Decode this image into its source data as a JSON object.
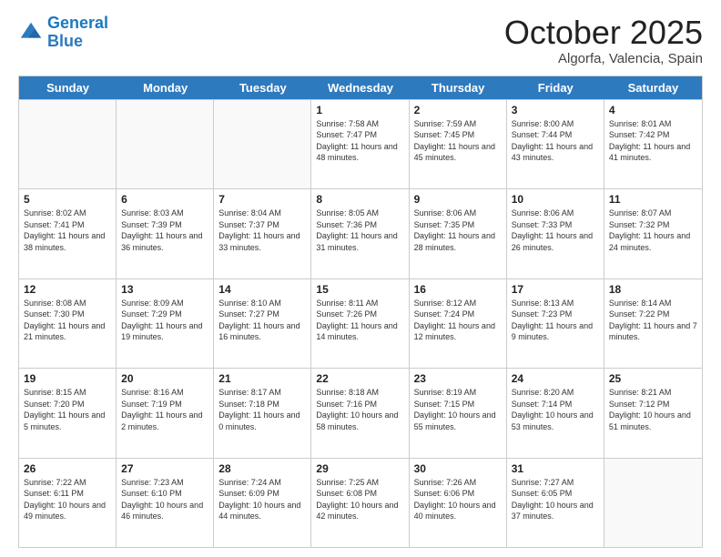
{
  "logo": {
    "line1": "General",
    "line2": "Blue"
  },
  "header": {
    "month": "October 2025",
    "location": "Algorfa, Valencia, Spain"
  },
  "weekdays": [
    "Sunday",
    "Monday",
    "Tuesday",
    "Wednesday",
    "Thursday",
    "Friday",
    "Saturday"
  ],
  "weeks": [
    [
      {
        "day": "",
        "sunrise": "",
        "sunset": "",
        "daylight": ""
      },
      {
        "day": "",
        "sunrise": "",
        "sunset": "",
        "daylight": ""
      },
      {
        "day": "",
        "sunrise": "",
        "sunset": "",
        "daylight": ""
      },
      {
        "day": "1",
        "sunrise": "Sunrise: 7:58 AM",
        "sunset": "Sunset: 7:47 PM",
        "daylight": "Daylight: 11 hours and 48 minutes."
      },
      {
        "day": "2",
        "sunrise": "Sunrise: 7:59 AM",
        "sunset": "Sunset: 7:45 PM",
        "daylight": "Daylight: 11 hours and 45 minutes."
      },
      {
        "day": "3",
        "sunrise": "Sunrise: 8:00 AM",
        "sunset": "Sunset: 7:44 PM",
        "daylight": "Daylight: 11 hours and 43 minutes."
      },
      {
        "day": "4",
        "sunrise": "Sunrise: 8:01 AM",
        "sunset": "Sunset: 7:42 PM",
        "daylight": "Daylight: 11 hours and 41 minutes."
      }
    ],
    [
      {
        "day": "5",
        "sunrise": "Sunrise: 8:02 AM",
        "sunset": "Sunset: 7:41 PM",
        "daylight": "Daylight: 11 hours and 38 minutes."
      },
      {
        "day": "6",
        "sunrise": "Sunrise: 8:03 AM",
        "sunset": "Sunset: 7:39 PM",
        "daylight": "Daylight: 11 hours and 36 minutes."
      },
      {
        "day": "7",
        "sunrise": "Sunrise: 8:04 AM",
        "sunset": "Sunset: 7:37 PM",
        "daylight": "Daylight: 11 hours and 33 minutes."
      },
      {
        "day": "8",
        "sunrise": "Sunrise: 8:05 AM",
        "sunset": "Sunset: 7:36 PM",
        "daylight": "Daylight: 11 hours and 31 minutes."
      },
      {
        "day": "9",
        "sunrise": "Sunrise: 8:06 AM",
        "sunset": "Sunset: 7:35 PM",
        "daylight": "Daylight: 11 hours and 28 minutes."
      },
      {
        "day": "10",
        "sunrise": "Sunrise: 8:06 AM",
        "sunset": "Sunset: 7:33 PM",
        "daylight": "Daylight: 11 hours and 26 minutes."
      },
      {
        "day": "11",
        "sunrise": "Sunrise: 8:07 AM",
        "sunset": "Sunset: 7:32 PM",
        "daylight": "Daylight: 11 hours and 24 minutes."
      }
    ],
    [
      {
        "day": "12",
        "sunrise": "Sunrise: 8:08 AM",
        "sunset": "Sunset: 7:30 PM",
        "daylight": "Daylight: 11 hours and 21 minutes."
      },
      {
        "day": "13",
        "sunrise": "Sunrise: 8:09 AM",
        "sunset": "Sunset: 7:29 PM",
        "daylight": "Daylight: 11 hours and 19 minutes."
      },
      {
        "day": "14",
        "sunrise": "Sunrise: 8:10 AM",
        "sunset": "Sunset: 7:27 PM",
        "daylight": "Daylight: 11 hours and 16 minutes."
      },
      {
        "day": "15",
        "sunrise": "Sunrise: 8:11 AM",
        "sunset": "Sunset: 7:26 PM",
        "daylight": "Daylight: 11 hours and 14 minutes."
      },
      {
        "day": "16",
        "sunrise": "Sunrise: 8:12 AM",
        "sunset": "Sunset: 7:24 PM",
        "daylight": "Daylight: 11 hours and 12 minutes."
      },
      {
        "day": "17",
        "sunrise": "Sunrise: 8:13 AM",
        "sunset": "Sunset: 7:23 PM",
        "daylight": "Daylight: 11 hours and 9 minutes."
      },
      {
        "day": "18",
        "sunrise": "Sunrise: 8:14 AM",
        "sunset": "Sunset: 7:22 PM",
        "daylight": "Daylight: 11 hours and 7 minutes."
      }
    ],
    [
      {
        "day": "19",
        "sunrise": "Sunrise: 8:15 AM",
        "sunset": "Sunset: 7:20 PM",
        "daylight": "Daylight: 11 hours and 5 minutes."
      },
      {
        "day": "20",
        "sunrise": "Sunrise: 8:16 AM",
        "sunset": "Sunset: 7:19 PM",
        "daylight": "Daylight: 11 hours and 2 minutes."
      },
      {
        "day": "21",
        "sunrise": "Sunrise: 8:17 AM",
        "sunset": "Sunset: 7:18 PM",
        "daylight": "Daylight: 11 hours and 0 minutes."
      },
      {
        "day": "22",
        "sunrise": "Sunrise: 8:18 AM",
        "sunset": "Sunset: 7:16 PM",
        "daylight": "Daylight: 10 hours and 58 minutes."
      },
      {
        "day": "23",
        "sunrise": "Sunrise: 8:19 AM",
        "sunset": "Sunset: 7:15 PM",
        "daylight": "Daylight: 10 hours and 55 minutes."
      },
      {
        "day": "24",
        "sunrise": "Sunrise: 8:20 AM",
        "sunset": "Sunset: 7:14 PM",
        "daylight": "Daylight: 10 hours and 53 minutes."
      },
      {
        "day": "25",
        "sunrise": "Sunrise: 8:21 AM",
        "sunset": "Sunset: 7:12 PM",
        "daylight": "Daylight: 10 hours and 51 minutes."
      }
    ],
    [
      {
        "day": "26",
        "sunrise": "Sunrise: 7:22 AM",
        "sunset": "Sunset: 6:11 PM",
        "daylight": "Daylight: 10 hours and 49 minutes."
      },
      {
        "day": "27",
        "sunrise": "Sunrise: 7:23 AM",
        "sunset": "Sunset: 6:10 PM",
        "daylight": "Daylight: 10 hours and 46 minutes."
      },
      {
        "day": "28",
        "sunrise": "Sunrise: 7:24 AM",
        "sunset": "Sunset: 6:09 PM",
        "daylight": "Daylight: 10 hours and 44 minutes."
      },
      {
        "day": "29",
        "sunrise": "Sunrise: 7:25 AM",
        "sunset": "Sunset: 6:08 PM",
        "daylight": "Daylight: 10 hours and 42 minutes."
      },
      {
        "day": "30",
        "sunrise": "Sunrise: 7:26 AM",
        "sunset": "Sunset: 6:06 PM",
        "daylight": "Daylight: 10 hours and 40 minutes."
      },
      {
        "day": "31",
        "sunrise": "Sunrise: 7:27 AM",
        "sunset": "Sunset: 6:05 PM",
        "daylight": "Daylight: 10 hours and 37 minutes."
      },
      {
        "day": "",
        "sunrise": "",
        "sunset": "",
        "daylight": ""
      }
    ]
  ]
}
